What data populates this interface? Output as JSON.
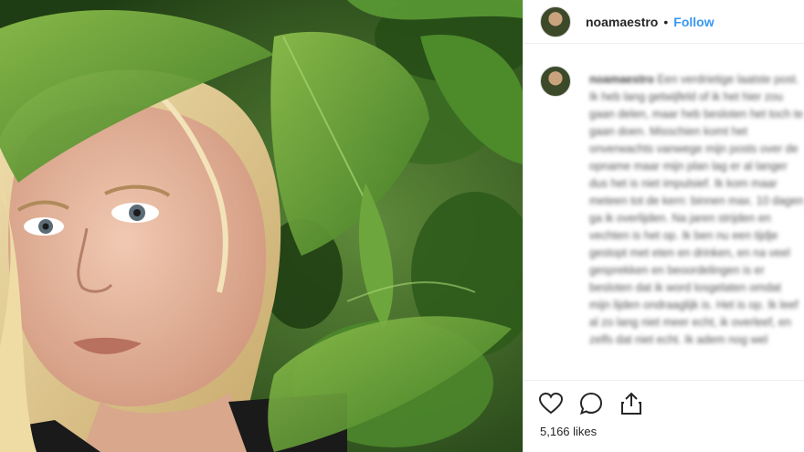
{
  "post": {
    "username": "noamaestro",
    "separator": "•",
    "follow_label": "Follow",
    "caption_user": "noamaestro",
    "caption_text": "Een verdrietige laatste post. Ik heb lang getwijfeld of ik het hier zou gaan delen, maar heb besloten het toch te gaan doen. Misschien komt het onverwachts vanwege mijn posts over de opname maar mijn plan lag er al langer dus het is niet impulsief. Ik kom maar meteen tot de kern: binnen max. 10 dagen ga ik overlijden. Na jaren strijden en vechten is het op. Ik ben nu een tijdje gestopt met eten en drinken, en na veel gesprekken en beoordelingen is er besloten dat ik word losgelaten omdat mijn lijden ondraaglijk is. Het is op. Ik leef al zo lang niet meer echt, ik overleef, en zelfs dat niet echt. Ik adem nog wel",
    "likes": "5,166 likes"
  },
  "icons": {
    "like": "heart-icon",
    "comment": "comment-icon",
    "share": "share-icon"
  }
}
